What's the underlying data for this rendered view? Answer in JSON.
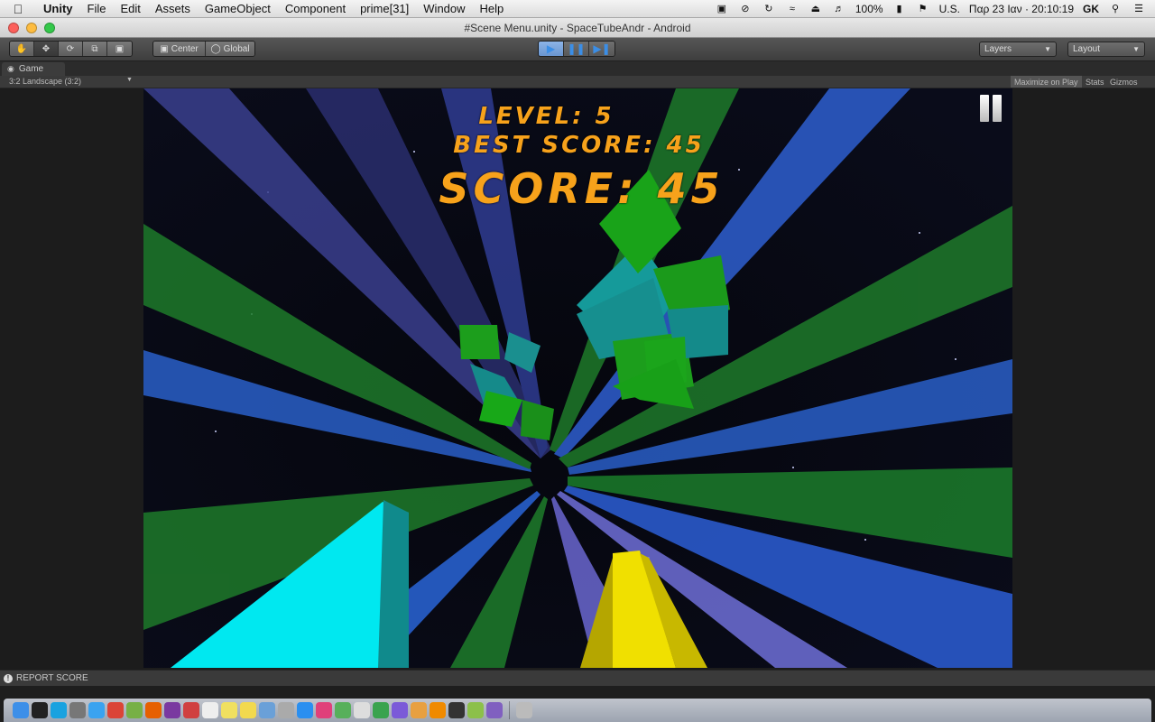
{
  "menubar": {
    "app_name": "Unity",
    "menus": [
      "File",
      "Edit",
      "Assets",
      "GameObject",
      "Component",
      "prime[31]",
      "Window",
      "Help"
    ],
    "battery": "100%",
    "input_source": "U.S.",
    "datetime": "Παρ 23 Ιαν · 20:10:19",
    "user": "GK"
  },
  "window": {
    "title": "#Scene Menu.unity - SpaceTubeAndr - Android"
  },
  "toolbar": {
    "pivot_label": "Center",
    "space_label": "Global",
    "layers_label": "Layers",
    "layout_label": "Layout"
  },
  "game_tab": {
    "label": "Game",
    "aspect": "3:2 Landscape (3:2)",
    "maximize_label": "Maximize on Play",
    "stats_label": "Stats",
    "gizmos_label": "Gizmos"
  },
  "hud": {
    "level_text": "LEVEL: 5",
    "best_text": "BEST SCORE: 45",
    "score_text": "SCORE: 45",
    "color": "#f7a21b"
  },
  "status": {
    "message": "REPORT SCORE"
  },
  "dock": {
    "icons": [
      {
        "name": "finder-icon",
        "color": "#3d8fe8"
      },
      {
        "name": "terminal-icon",
        "color": "#222"
      },
      {
        "name": "skype-icon",
        "color": "#19a2e0"
      },
      {
        "name": "system-preferences-icon",
        "color": "#777"
      },
      {
        "name": "safari-icon",
        "color": "#3aa3f0"
      },
      {
        "name": "chrome-icon",
        "color": "#db4437"
      },
      {
        "name": "utorrent-icon",
        "color": "#77b046"
      },
      {
        "name": "firefox-icon",
        "color": "#e66000"
      },
      {
        "name": "onenote-icon",
        "color": "#7a3aa0"
      },
      {
        "name": "app-icon-red",
        "color": "#d04040"
      },
      {
        "name": "calendar-icon",
        "color": "#eee"
      },
      {
        "name": "notes-icon",
        "color": "#f0e060"
      },
      {
        "name": "stickies-icon",
        "color": "#f2d94e"
      },
      {
        "name": "preview-icon",
        "color": "#6aa0d8"
      },
      {
        "name": "launchpad-icon",
        "color": "#aaa"
      },
      {
        "name": "app-store-icon",
        "color": "#2a8ff0"
      },
      {
        "name": "itunes-icon",
        "color": "#e0407a"
      },
      {
        "name": "maps-icon",
        "color": "#57b05a"
      },
      {
        "name": "textedit-icon",
        "color": "#ddd"
      },
      {
        "name": "numbers-icon",
        "color": "#3aa34e"
      },
      {
        "name": "imovie-icon",
        "color": "#7b5ad8"
      },
      {
        "name": "photo-icon",
        "color": "#e8a040"
      },
      {
        "name": "vlc-icon",
        "color": "#f08a00"
      },
      {
        "name": "unity-icon",
        "color": "#333"
      },
      {
        "name": "android-icon",
        "color": "#8cc04a"
      },
      {
        "name": "app-icon-purple",
        "color": "#8060c0"
      },
      {
        "name": "trash-icon",
        "color": "#bbb"
      }
    ]
  }
}
